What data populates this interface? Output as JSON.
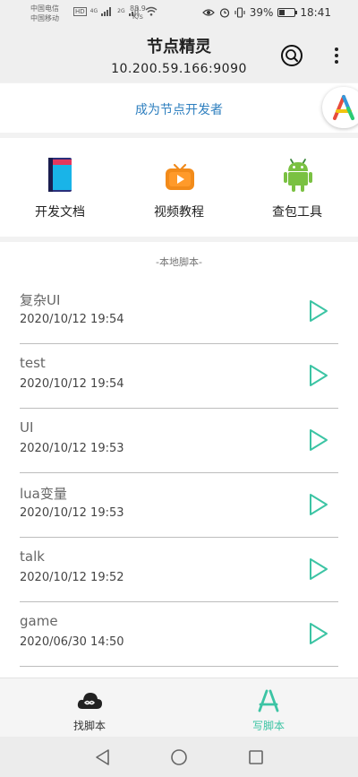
{
  "status_bar": {
    "carrier_1": "中国电信",
    "carrier_2": "中国移动",
    "hd_badge": "HD",
    "signal_1_label": "4G",
    "signal_2_label": "2G",
    "net_speed_value": "88.9",
    "net_speed_unit": "K/s",
    "battery": "39%",
    "time": "18:41"
  },
  "header": {
    "title": "节点精灵",
    "subtitle": "10.200.59.166:9090"
  },
  "dev_banner": {
    "link_text": "成为节点开发者"
  },
  "tools": [
    {
      "label": "开发文档",
      "icon": "book-icon"
    },
    {
      "label": "视频教程",
      "icon": "tv-icon"
    },
    {
      "label": "查包工具",
      "icon": "android-icon"
    }
  ],
  "scripts_section": {
    "title": "-本地脚本-",
    "items": [
      {
        "name": "复杂UI",
        "date": "2020/10/12 19:54"
      },
      {
        "name": "test",
        "date": "2020/10/12 19:54"
      },
      {
        "name": "UI",
        "date": "2020/10/12 19:53"
      },
      {
        "name": "lua变量",
        "date": "2020/10/12 19:53"
      },
      {
        "name": "talk",
        "date": "2020/10/12 19:52"
      },
      {
        "name": "game",
        "date": "2020/06/30 14:50"
      }
    ]
  },
  "tabbar": {
    "find_label": "找脚本",
    "write_label": "写脚本",
    "active_color": "#3cc4a4"
  },
  "colors": {
    "accent": "#3cc4a4",
    "link": "#2e7fbf"
  }
}
